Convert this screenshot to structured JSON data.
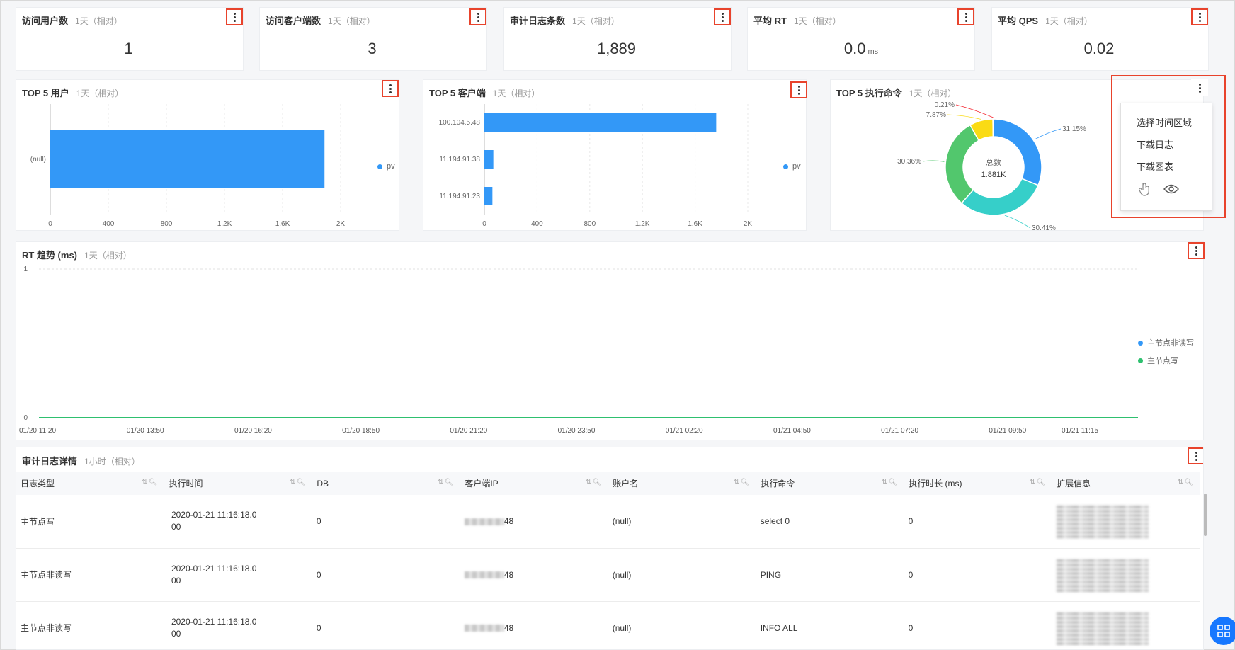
{
  "kpis": [
    {
      "title": "访问用户数",
      "sub": "1天（相对）",
      "value": "1",
      "unit": ""
    },
    {
      "title": "访问客户端数",
      "sub": "1天（相对）",
      "value": "3",
      "unit": ""
    },
    {
      "title": "审计日志条数",
      "sub": "1天（相对）",
      "value": "1,889",
      "unit": ""
    },
    {
      "title": "平均 RT",
      "sub": "1天（相对）",
      "value": "0.0",
      "unit": "ms"
    },
    {
      "title": "平均 QPS",
      "sub": "1天（相对）",
      "value": "0.02",
      "unit": ""
    }
  ],
  "top_users": {
    "title": "TOP 5 用户",
    "sub": "1天（相对）",
    "legend": "pv"
  },
  "top_clients": {
    "title": "TOP 5 客户端",
    "sub": "1天（相对）",
    "legend": "pv"
  },
  "top_commands": {
    "title": "TOP 5 执行命令",
    "sub": "1天（相对）",
    "center_label": "总数",
    "center_value": "1.881K"
  },
  "rt_trend": {
    "title": "RT 趋势 (ms)",
    "sub": "1天（相对）"
  },
  "menu": {
    "items": [
      "选择时间区域",
      "下载日志",
      "下载图表"
    ],
    "icons": [
      "hand-pointer-icon",
      "eye-icon"
    ]
  },
  "audit": {
    "title": "审计日志详情",
    "sub": "1小时（相对）",
    "columns": [
      "日志类型",
      "执行时间",
      "DB",
      "客户端IP",
      "账户名",
      "执行命令",
      "执行时长 (ms)",
      "扩展信息"
    ],
    "rows": [
      {
        "type": "主节点写",
        "time_a": "2020-01-21 11:16:18.0",
        "time_b": "00",
        "db": "0",
        "ip_suffix": "48",
        "account": "(null)",
        "command": "select 0",
        "duration": "0"
      },
      {
        "type": "主节点非读写",
        "time_a": "2020-01-21 11:16:18.0",
        "time_b": "00",
        "db": "0",
        "ip_suffix": "48",
        "account": "(null)",
        "command": "PING",
        "duration": "0"
      },
      {
        "type": "主节点非读写",
        "time_a": "2020-01-21 11:16:18.0",
        "time_b": "00",
        "db": "0",
        "ip_suffix": "48",
        "account": "(null)",
        "command": "INFO ALL",
        "duration": "0"
      }
    ]
  },
  "colors": {
    "accent": "#3398f7",
    "highlight": "#e8432c",
    "green": "#2ec06f",
    "teal": "#36cfc9",
    "yellow": "#fadb14"
  },
  "chart_data": [
    {
      "type": "bar",
      "orientation": "horizontal",
      "title": "TOP 5 用户",
      "categories": [
        "(null)"
      ],
      "series": [
        {
          "name": "pv",
          "values": [
            1889
          ]
        }
      ],
      "xlim": [
        0,
        2000
      ],
      "xticks": [
        "0",
        "400",
        "800",
        "1.2K",
        "1.6K",
        "2K"
      ],
      "legend": "right"
    },
    {
      "type": "bar",
      "orientation": "horizontal",
      "title": "TOP 5 客户端",
      "categories": [
        "100.104.5.48",
        "11.194.91.38",
        "11.194.91.23"
      ],
      "series": [
        {
          "name": "pv",
          "values": [
            1760,
            68,
            61
          ]
        }
      ],
      "xlim": [
        0,
        2000
      ],
      "xticks": [
        "0",
        "400",
        "800",
        "1.2K",
        "1.6K",
        "2K"
      ],
      "legend": "right"
    },
    {
      "type": "pie",
      "title": "TOP 5 执行命令",
      "slices": [
        {
          "label": "31.15%",
          "value": 31.15,
          "color": "#3398f7"
        },
        {
          "label": "30.41%",
          "value": 30.41,
          "color": "#36cfc9"
        },
        {
          "label": "30.36%",
          "value": 30.36,
          "color": "#52c76d"
        },
        {
          "label": "7.87%",
          "value": 7.87,
          "color": "#fadb14"
        },
        {
          "label": "0.21%",
          "value": 0.21,
          "color": "#f5222d"
        }
      ]
    },
    {
      "type": "line",
      "title": "RT 趋势 (ms)",
      "x": [
        "01/20 11:20",
        "01/20 13:50",
        "01/20 16:20",
        "01/20 18:50",
        "01/20 21:20",
        "01/20 23:50",
        "01/21 02:20",
        "01/21 04:50",
        "01/21 07:20",
        "01/21 09:50",
        "01/21 11:15"
      ],
      "series": [
        {
          "name": "主节点非读写",
          "color": "#3398f7",
          "values": [
            0,
            0,
            0,
            0,
            0,
            0,
            0,
            0,
            0,
            0,
            0
          ]
        },
        {
          "name": "主节点写",
          "color": "#2ec06f",
          "values": [
            0,
            0,
            0,
            0,
            0,
            0,
            0,
            0,
            0,
            0,
            0
          ]
        }
      ],
      "ylim": [
        0,
        1
      ],
      "yticks": [
        "0",
        "1"
      ],
      "legend": "right"
    }
  ]
}
